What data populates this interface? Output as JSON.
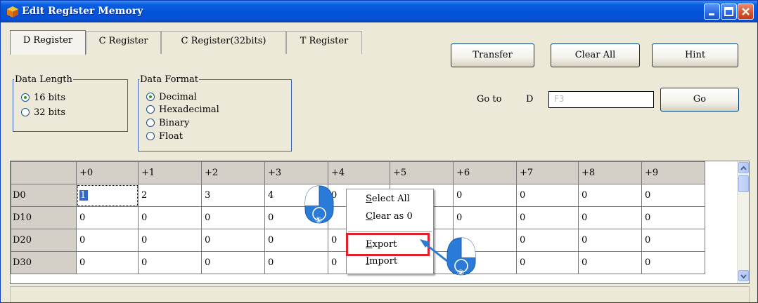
{
  "window": {
    "title": "Edit Register Memory"
  },
  "tabs": [
    {
      "label": "D Register",
      "active": true
    },
    {
      "label": "C Register",
      "active": false
    },
    {
      "label": "C Register(32bits)",
      "active": false
    },
    {
      "label": "T Register",
      "active": false
    }
  ],
  "toolbar": {
    "transfer_label": "Transfer",
    "clear_all_label": "Clear All",
    "hint_label": "Hint"
  },
  "data_length": {
    "legend": "Data Length",
    "options": [
      "16 bits",
      "32 bits"
    ],
    "selected": "16 bits"
  },
  "data_format": {
    "legend": "Data Format",
    "options": [
      "Decimal",
      "Hexadecimal",
      "Binary",
      "Float"
    ],
    "selected": "Decimal"
  },
  "goto": {
    "label": "Go to",
    "device": "D",
    "placeholder": "F3",
    "button_label": "Go"
  },
  "grid": {
    "columns": [
      "+0",
      "+1",
      "+2",
      "+3",
      "+4",
      "+5",
      "+6",
      "+7",
      "+8",
      "+9"
    ],
    "rows": [
      {
        "label": "D0",
        "values": [
          "1",
          "2",
          "3",
          "4",
          "0",
          "",
          "0",
          "0",
          "0",
          "0"
        ]
      },
      {
        "label": "D10",
        "values": [
          "0",
          "0",
          "0",
          "0",
          "",
          "",
          "0",
          "0",
          "0",
          "0"
        ]
      },
      {
        "label": "D20",
        "values": [
          "0",
          "0",
          "0",
          "0",
          "0",
          "",
          "",
          "0",
          "0",
          "0"
        ]
      },
      {
        "label": "D30",
        "values": [
          "0",
          "0",
          "0",
          "0",
          "0",
          "",
          "",
          "0",
          "0",
          "0"
        ]
      }
    ],
    "selected_cell": "D0 +0"
  },
  "context_menu": {
    "items": [
      {
        "label": "Select All",
        "mnemonic": "S"
      },
      {
        "label": "Clear as 0",
        "mnemonic": "C"
      },
      {
        "label": "Export",
        "mnemonic": "E",
        "highlighted": true
      },
      {
        "label": "Import",
        "mnemonic": "I"
      }
    ]
  },
  "callouts": [
    {
      "number": "①"
    },
    {
      "number": "②"
    }
  ],
  "colors": {
    "title_bar": "#0454d8",
    "callout_blue": "#2a7ad8",
    "highlight_red": "#e0202a"
  }
}
